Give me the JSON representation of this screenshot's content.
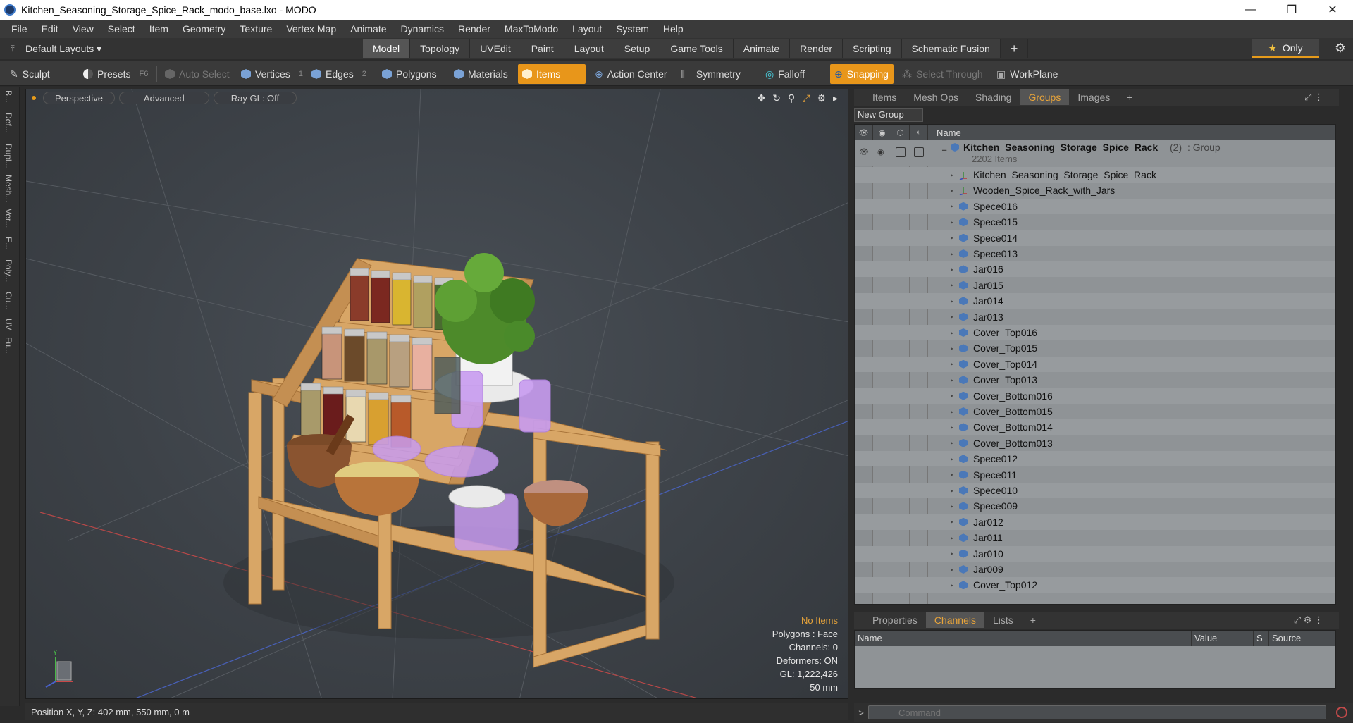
{
  "window": {
    "title": "Kitchen_Seasoning_Storage_Spice_Rack_modo_base.lxo - MODO",
    "minimize": "—",
    "restore": "❐",
    "close": "✕"
  },
  "menu": [
    "File",
    "Edit",
    "View",
    "Select",
    "Item",
    "Geometry",
    "Texture",
    "Vertex Map",
    "Animate",
    "Dynamics",
    "Render",
    "MaxToModo",
    "Layout",
    "System",
    "Help"
  ],
  "layouts": {
    "dropdown": "Default Layouts ▾",
    "tabs": [
      "Model",
      "Topology",
      "UVEdit",
      "Paint",
      "Layout",
      "Setup",
      "Game Tools",
      "Animate",
      "Render",
      "Scripting",
      "Schematic Fusion"
    ],
    "active_tab": "Model",
    "add": "+",
    "only_label": "Only",
    "only_star": "★"
  },
  "toolbar": {
    "sculpt": "Sculpt",
    "presets": "Presets",
    "presets_key": "F6",
    "auto_select": "Auto Select",
    "vertices": "Vertices",
    "vertices_num": "1",
    "edges": "Edges",
    "edges_num": "2",
    "polygons": "Polygons",
    "materials": "Materials",
    "items": "Items",
    "action_center": "Action Center",
    "symmetry": "Symmetry",
    "falloff": "Falloff",
    "snapping": "Snapping",
    "select_through": "Select Through",
    "workplane": "WorkPlane"
  },
  "left_tabs": [
    "B...",
    "Def...",
    "Dupl...",
    "Mesh...",
    "Ver...",
    "E...",
    "Poly...",
    "Cu...",
    "UV",
    "Fu..."
  ],
  "viewport": {
    "perspective": "Perspective",
    "advanced": "Advanced",
    "raygl": "Ray GL: Off",
    "info": {
      "no_items": "No Items",
      "polygons": "Polygons : Face",
      "channels": "Channels: 0",
      "deformers": "Deformers: ON",
      "gl": "GL: 1,222,426",
      "size": "50 mm"
    }
  },
  "status": {
    "position": "Position X, Y, Z:   402 mm, 550 mm, 0 m"
  },
  "right_panel": {
    "tabs": [
      "Items",
      "Mesh Ops",
      "Shading",
      "Groups",
      "Images"
    ],
    "active_tab": "Groups",
    "add": "+",
    "new_group": "New Group",
    "name_header": "Name",
    "group": {
      "name": "Kitchen_Seasoning_Storage_Spice_Rack",
      "count": "(2)",
      "type": ": Group",
      "items_count": "2202 Items"
    },
    "items": [
      {
        "label": "Kitchen_Seasoning_Storage_Spice_Rack",
        "icon": "locator-icon"
      },
      {
        "label": "Wooden_Spice_Rack_with_Jars",
        "icon": "locator-icon"
      },
      {
        "label": "Spece016",
        "icon": "mesh-icon"
      },
      {
        "label": "Spece015",
        "icon": "mesh-icon"
      },
      {
        "label": "Spece014",
        "icon": "mesh-icon"
      },
      {
        "label": "Spece013",
        "icon": "mesh-icon"
      },
      {
        "label": "Jar016",
        "icon": "mesh-icon"
      },
      {
        "label": "Jar015",
        "icon": "mesh-icon"
      },
      {
        "label": "Jar014",
        "icon": "mesh-icon"
      },
      {
        "label": "Jar013",
        "icon": "mesh-icon"
      },
      {
        "label": "Cover_Top016",
        "icon": "mesh-icon"
      },
      {
        "label": "Cover_Top015",
        "icon": "mesh-icon"
      },
      {
        "label": "Cover_Top014",
        "icon": "mesh-icon"
      },
      {
        "label": "Cover_Top013",
        "icon": "mesh-icon"
      },
      {
        "label": "Cover_Bottom016",
        "icon": "mesh-icon"
      },
      {
        "label": "Cover_Bottom015",
        "icon": "mesh-icon"
      },
      {
        "label": "Cover_Bottom014",
        "icon": "mesh-icon"
      },
      {
        "label": "Cover_Bottom013",
        "icon": "mesh-icon"
      },
      {
        "label": "Spece012",
        "icon": "mesh-icon"
      },
      {
        "label": "Spece011",
        "icon": "mesh-icon"
      },
      {
        "label": "Spece010",
        "icon": "mesh-icon"
      },
      {
        "label": "Spece009",
        "icon": "mesh-icon"
      },
      {
        "label": "Jar012",
        "icon": "mesh-icon"
      },
      {
        "label": "Jar011",
        "icon": "mesh-icon"
      },
      {
        "label": "Jar010",
        "icon": "mesh-icon"
      },
      {
        "label": "Jar009",
        "icon": "mesh-icon"
      },
      {
        "label": "Cover_Top012",
        "icon": "mesh-icon"
      }
    ]
  },
  "lower_panel": {
    "tabs": [
      "Properties",
      "Channels",
      "Lists"
    ],
    "active_tab": "Channels",
    "add": "+",
    "columns": [
      "Name",
      "Value",
      "S",
      "Source"
    ]
  },
  "command": {
    "prompt": ">",
    "placeholder": "Command"
  },
  "colors": {
    "accent": "#e8961a",
    "selection_purple": "#c89cf0",
    "wood": "#d9a86a"
  }
}
